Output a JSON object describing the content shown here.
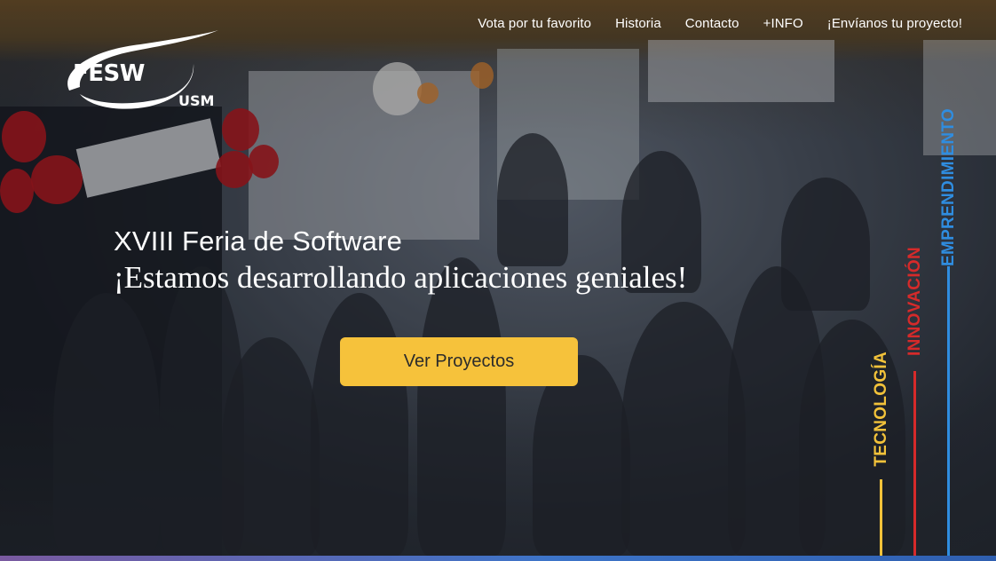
{
  "nav": {
    "items": [
      "Vota por tu favorito",
      "Historia",
      "Contacto",
      "+INFO",
      "¡Envíanos tu proyecto!"
    ]
  },
  "logo": {
    "main": "FESW",
    "sub": "USM"
  },
  "hero": {
    "title": "XVIII Feria de Software",
    "subtitle": "¡Estamos desarrollando aplicaciones geniales!",
    "cta_label": "Ver Proyectos"
  },
  "pillars": [
    {
      "label": "TECNOLOGÍA",
      "color": "#f2c23a"
    },
    {
      "label": "INNOVACIÓN",
      "color": "#d62a2a"
    },
    {
      "label": "EMPRENDIMIENTO",
      "color": "#2f8de0"
    }
  ],
  "colors": {
    "accent": "#f6c23b",
    "text": "#ffffff"
  }
}
